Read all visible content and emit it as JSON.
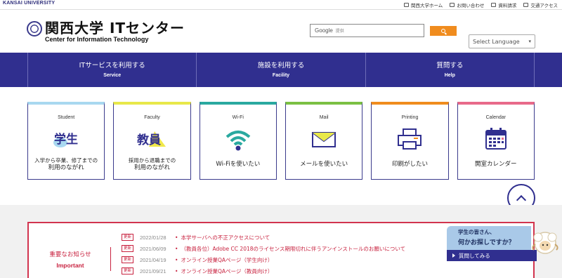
{
  "topbar": {
    "university": "KANSAI UNIVERSITY",
    "links": [
      {
        "label": "関西大学ホーム",
        "icon": "external-window-icon"
      },
      {
        "label": "お問い合わせ",
        "icon": "mail-icon"
      },
      {
        "label": "資料請求",
        "icon": "document-icon"
      },
      {
        "label": "交通アクセス",
        "icon": "map-icon"
      }
    ]
  },
  "header": {
    "logo_jp": "関西大学 ITセンター",
    "logo_en": "Center for Information Technology",
    "search_brand": "Google",
    "search_placeholder": "提供",
    "language_select": "Select Language"
  },
  "nav": [
    {
      "jp": "ITサービスを利用する",
      "en": "Service"
    },
    {
      "jp": "施設を利用する",
      "en": "Facility"
    },
    {
      "jp": "質問する",
      "en": "Help"
    }
  ],
  "cards": [
    {
      "title": "Student",
      "line1": "入学から卒業、修了までの",
      "line2": "利用のながれ",
      "icon": "student-icon",
      "accent": "#a8d8f0"
    },
    {
      "title": "Faculty",
      "line1": "採用から退職までの",
      "line2": "利用のながれ",
      "icon": "faculty-icon",
      "accent": "#e8e84a"
    },
    {
      "title": "Wi-Fi",
      "line1": "",
      "line2": "Wi-Fiを使いたい",
      "icon": "wifi-icon",
      "accent": "#2aa9a0"
    },
    {
      "title": "Mail",
      "line1": "",
      "line2": "メールを使いたい",
      "icon": "mail-envelope-icon",
      "accent": "#7bc043"
    },
    {
      "title": "Printing",
      "line1": "",
      "line2": "印刷がしたい",
      "icon": "printer-icon",
      "accent": "#f08c1e"
    },
    {
      "title": "Calendar",
      "line1": "",
      "line2": "開室カレンダー",
      "icon": "calendar-icon",
      "accent": "#e86a8a"
    }
  ],
  "news": {
    "label_jp": "重要なお知らせ",
    "label_en": "Important",
    "badge": "更新",
    "items": [
      {
        "date": "2022/01/28",
        "title": "本学サーバへの不正アクセスについて"
      },
      {
        "date": "2021/06/09",
        "title": "（教員各位）Adobe CC 2018のライセンス期限切れに伴うアンインストールのお願いについて"
      },
      {
        "date": "2021/04/19",
        "title": "オンライン授業QAページ（学生向け）"
      },
      {
        "date": "2021/09/21",
        "title": "オンライン授業QAページ（教員向け）"
      }
    ]
  },
  "help_widget": {
    "line1": "学生の皆さん、",
    "line2": "何かお探しですか？",
    "button": "質問してみる"
  },
  "colors": {
    "brand": "#302f8f",
    "important": "#c8223f",
    "search_button": "#f08c1e"
  }
}
